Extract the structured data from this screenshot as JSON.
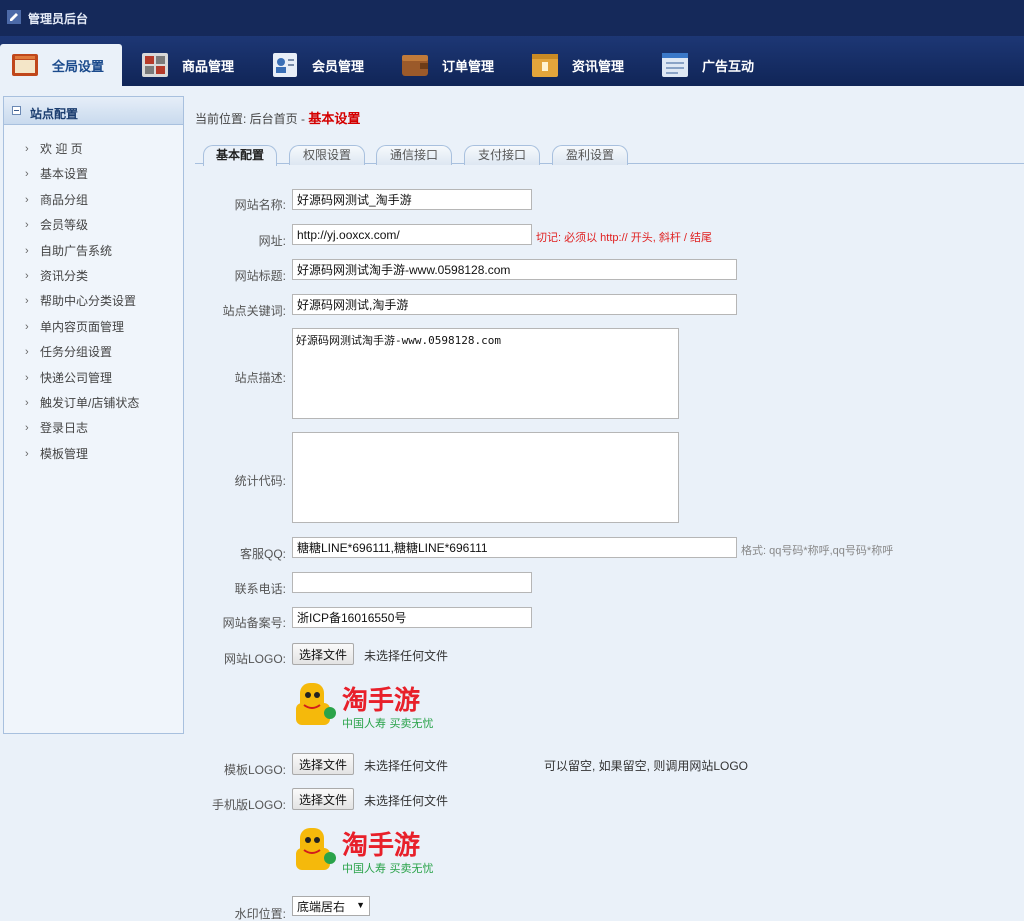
{
  "app": {
    "title": "管理员后台"
  },
  "nav": {
    "items": [
      {
        "label": "全局设置",
        "icon": "settings-window-icon"
      },
      {
        "label": "商品管理",
        "icon": "goods-grid-icon"
      },
      {
        "label": "会员管理",
        "icon": "member-card-icon"
      },
      {
        "label": "订单管理",
        "icon": "order-wallet-icon"
      },
      {
        "label": "资讯管理",
        "icon": "news-folder-icon"
      },
      {
        "label": "广告互动",
        "icon": "ad-window-icon"
      }
    ]
  },
  "sidebar": {
    "header": "站点配置",
    "items": [
      {
        "label": "欢 迎 页"
      },
      {
        "label": "基本设置"
      },
      {
        "label": "商品分组"
      },
      {
        "label": "会员等级"
      },
      {
        "label": "自助广告系统"
      },
      {
        "label": "资讯分类"
      },
      {
        "label": "帮助中心分类设置"
      },
      {
        "label": "单内容页面管理"
      },
      {
        "label": "任务分组设置"
      },
      {
        "label": "快递公司管理"
      },
      {
        "label": "触发订单/店铺状态"
      },
      {
        "label": "登录日志"
      },
      {
        "label": "模板管理"
      }
    ]
  },
  "breadcrumb": {
    "prefix": "当前位置: 后台首页 - ",
    "current": "基本设置"
  },
  "tabs": [
    {
      "label": "基本配置"
    },
    {
      "label": "权限设置"
    },
    {
      "label": "通信接口"
    },
    {
      "label": "支付接口"
    },
    {
      "label": "盈利设置"
    }
  ],
  "form": {
    "site_name": {
      "label": "网站名称:",
      "value": "好源码网测试_淘手游"
    },
    "site_url": {
      "label": "网址:",
      "value": "http://yj.ooxcx.com/",
      "note": "切记: 必须以 http:// 开头, 斜杆 / 结尾"
    },
    "site_title": {
      "label": "网站标题:",
      "value": "好源码网测试淘手游-www.0598128.com"
    },
    "site_keywords": {
      "label": "站点关键词:",
      "value": "好源码网测试,淘手游"
    },
    "site_desc": {
      "label": "站点描述:",
      "value": "好源码网测试淘手游-www.0598128.com"
    },
    "stats_code": {
      "label": "统计代码:",
      "value": ""
    },
    "service_qq": {
      "label": "客服QQ:",
      "value": "糖糖LINE*696111,糖糖LINE*696111",
      "note": "格式: qq号码*称呼,qq号码*称呼"
    },
    "phone": {
      "label": "联系电话:",
      "value": ""
    },
    "icp": {
      "label": "网站备案号:",
      "value": "浙ICP备16016550号"
    },
    "site_logo": {
      "label": "网站LOGO:",
      "button": "选择文件",
      "status": "未选择任何文件"
    },
    "template_logo": {
      "label": "模板LOGO:",
      "button": "选择文件",
      "status": "未选择任何文件",
      "note": "可以留空, 如果留空, 则调用网站LOGO"
    },
    "mobile_logo": {
      "label": "手机版LOGO:",
      "button": "选择文件",
      "status": "未选择任何文件"
    },
    "watermark": {
      "label": "水印位置:",
      "value": "底端居右"
    }
  },
  "logo_image": {
    "brand": "淘手游",
    "slogan": "中国人寿 买卖无忧"
  }
}
